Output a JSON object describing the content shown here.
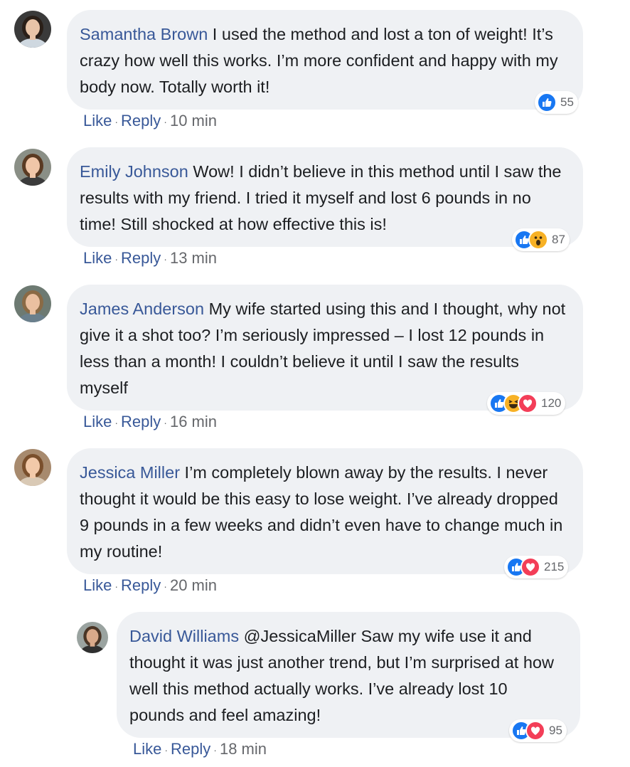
{
  "comments": [
    {
      "author": "Samantha Brown",
      "text": " I used the method and lost a ton of weight! It’s crazy how well this works. I’m more confident and happy with my body now. Totally worth it!",
      "reactions": [
        "like"
      ],
      "reaction_count": "55",
      "like_label": "Like",
      "reply_label": "Reply",
      "time": "10 min",
      "avatar_colors": {
        "bg": "#3a3a3a",
        "hair": "#2a1f18",
        "skin": "#e8c4a8",
        "shirt": "#cfd8e0"
      }
    },
    {
      "author": "Emily Johnson",
      "text": " Wow! I didn’t believe in this method until I saw the results with my friend. I tried it myself and lost 6 pounds in no time! Still shocked at how effective this is!",
      "reactions": [
        "like",
        "wow"
      ],
      "reaction_count": "87",
      "like_label": "Like",
      "reply_label": "Reply",
      "time": "13 min",
      "avatar_colors": {
        "bg": "#8a8f86",
        "hair": "#5a3a22",
        "skin": "#f0c6a8",
        "shirt": "#3b3b3b"
      }
    },
    {
      "author": "James Anderson",
      "text": " My wife started using this and I thought, why not give it a shot too? I’m seriously impressed – I lost 12 pounds in less than a month! I couldn’t believe it until I saw the results myself",
      "reactions": [
        "like",
        "haha",
        "love"
      ],
      "reaction_count": "120",
      "like_label": "Like",
      "reply_label": "Reply",
      "time": "16 min",
      "avatar_colors": {
        "bg": "#6d7a72",
        "hair": "#8a6a45",
        "skin": "#eac0a0",
        "shirt": "#6a7f8c"
      }
    },
    {
      "author": "Jessica Miller",
      "text": " I’m completely blown away by the results. I never thought it would be this easy to lose weight. I’ve already dropped 9 pounds in a few weeks and didn’t even have to change much in my routine!",
      "reactions": [
        "like",
        "love"
      ],
      "reaction_count": "215",
      "like_label": "Like",
      "reply_label": "Reply",
      "time": "20 min",
      "avatar_colors": {
        "bg": "#a78a6e",
        "hair": "#7a4f2c",
        "skin": "#f2c9a9",
        "shirt": "#d9c9b5"
      }
    },
    {
      "author": "David Williams",
      "text": " @JessicaMiller Saw my wife use it and thought it was just another trend, but I’m surprised at how well this method actually works. I’ve already lost 10 pounds and feel amazing!",
      "reactions": [
        "like",
        "love"
      ],
      "reaction_count": "95",
      "like_label": "Like",
      "reply_label": "Reply",
      "time": "18 min",
      "avatar_colors": {
        "bg": "#9aa3a0",
        "hair": "#4a3526",
        "skin": "#d9a98a",
        "shirt": "#2f2f2f"
      }
    }
  ]
}
